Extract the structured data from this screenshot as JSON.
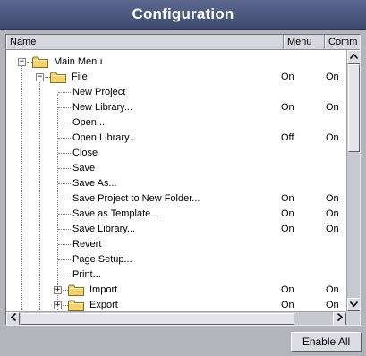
{
  "window": {
    "title": "Configuration"
  },
  "columns": {
    "name": "Name",
    "menu": "Menu",
    "comm": "Comm"
  },
  "tree": [
    {
      "label": "Main Menu",
      "level": 0,
      "type": "folder",
      "expanded": true,
      "menu": "",
      "comm": ""
    },
    {
      "label": "File",
      "level": 1,
      "type": "folder",
      "expanded": true,
      "menu": "On",
      "comm": "On"
    },
    {
      "label": "New Project",
      "level": 2,
      "type": "item",
      "menu": "",
      "comm": ""
    },
    {
      "label": "New Library...",
      "level": 2,
      "type": "item",
      "menu": "On",
      "comm": "On"
    },
    {
      "label": "Open...",
      "level": 2,
      "type": "item",
      "menu": "",
      "comm": ""
    },
    {
      "label": "Open Library...",
      "level": 2,
      "type": "item",
      "menu": "Off",
      "comm": "On"
    },
    {
      "label": "Close",
      "level": 2,
      "type": "item",
      "menu": "",
      "comm": ""
    },
    {
      "label": "Save",
      "level": 2,
      "type": "item",
      "menu": "",
      "comm": ""
    },
    {
      "label": "Save As...",
      "level": 2,
      "type": "item",
      "menu": "",
      "comm": ""
    },
    {
      "label": "Save Project to New Folder...",
      "level": 2,
      "type": "item",
      "menu": "On",
      "comm": "On"
    },
    {
      "label": "Save as Template...",
      "level": 2,
      "type": "item",
      "menu": "On",
      "comm": "On"
    },
    {
      "label": "Save Library...",
      "level": 2,
      "type": "item",
      "menu": "On",
      "comm": "On"
    },
    {
      "label": "Revert",
      "level": 2,
      "type": "item",
      "menu": "",
      "comm": ""
    },
    {
      "label": "Page Setup...",
      "level": 2,
      "type": "item",
      "menu": "",
      "comm": ""
    },
    {
      "label": "Print...",
      "level": 2,
      "type": "item",
      "menu": "",
      "comm": ""
    },
    {
      "label": "Import",
      "level": 2,
      "type": "folder",
      "expanded": false,
      "menu": "On",
      "comm": "On"
    },
    {
      "label": "Export",
      "level": 2,
      "type": "folder",
      "expanded": false,
      "menu": "On",
      "comm": "On"
    }
  ],
  "buttons": {
    "enable_all": "Enable All"
  },
  "icons": {
    "expanded": "minus-box",
    "collapsed": "plus-box",
    "folder": "folder-icon",
    "scroll_up": "arrow-up",
    "scroll_down": "arrow-down",
    "scroll_left": "arrow-left",
    "scroll_right": "arrow-right"
  },
  "colors": {
    "title_bar": "#4a5478",
    "background": "#b4b4bc",
    "folder": "#f3d36b"
  }
}
